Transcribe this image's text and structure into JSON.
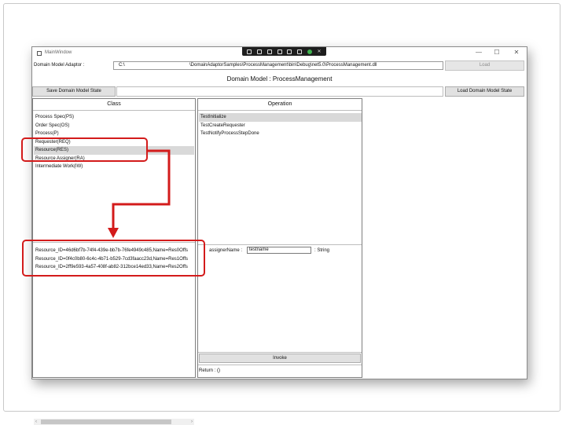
{
  "window": {
    "title": "MainWindow",
    "debug_toolbar_icons": [
      "live-tree-icon",
      "pointer-icon",
      "select-icon",
      "display-icon",
      "hot-reload-icon",
      "layout-icon",
      "check-icon",
      "close-icon"
    ],
    "controls": [
      "—",
      "☐",
      "✕"
    ]
  },
  "adaptor": {
    "label": "Domain Model Adaptor :",
    "path_drive": "C:\\",
    "path_rest": "\\DomainAdaptorSamples\\ProcessManagement\\bin\\Debug\\net5.0\\ProcessManagement.dll",
    "load_button": "Load"
  },
  "model_title": "Domain Model : ProcessManagement",
  "save_state_button": "Save Domain Model State",
  "load_state_button": "Load Domain Model State",
  "class_panel": {
    "header": "Class",
    "classes": [
      "Process Spec(PS)",
      "Order Spec(OS)",
      "Process(P)",
      "Requester(REQ)",
      "Resource(RES)",
      "Resource Assigner(RA)",
      "Intermediate Work(IW)"
    ],
    "selected_index": 4,
    "instances": [
      "Resource_ID=46d6bf7b-74f4-439e-bb7b-76fe4949c485,Name=Res0Offs",
      "Resource_ID=0f4c0b80-6c4c-4b71-b529-7cd3faacc23d,Name=Res1Offs",
      "Resource_ID=2ff9e593-4a57-408f-ab82-312bce14ed33,Name=Res2Offs"
    ],
    "scroll_left": "‹",
    "scroll_right": "›"
  },
  "operation_panel": {
    "header": "Operation",
    "operations": [
      "TestInitialize",
      "TestCreateRequester",
      "TestNotifyProcessStepDone"
    ],
    "selected_index": 0,
    "parameter": {
      "name": "assignerName",
      "separator": ":",
      "value": "testname",
      "type_separator": ":",
      "type": "String"
    },
    "invoke_button": "Invoke",
    "return_text": "Return : ()"
  },
  "annotation": {
    "color": "#d31b1b"
  }
}
